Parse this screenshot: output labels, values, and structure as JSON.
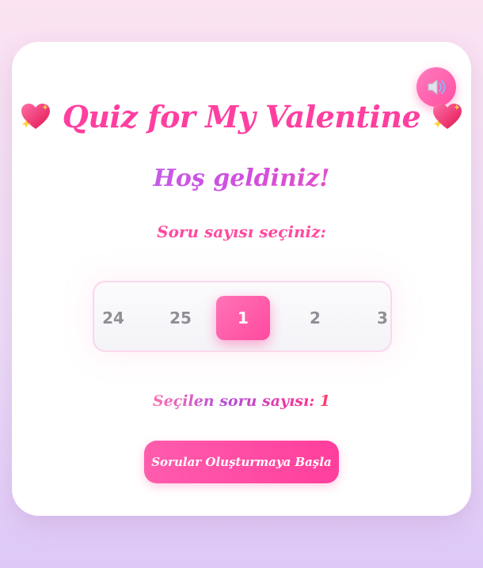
{
  "sound_button": {
    "icon": "speaker-icon"
  },
  "header": {
    "title": "Quiz for My Valentine",
    "left_icon": "sparkling-heart-icon",
    "right_icon": "sparkling-heart-icon"
  },
  "welcome": "Hoş geldiniz!",
  "prompt": "Soru sayısı seçiniz:",
  "picker": {
    "items": [
      "24",
      "25",
      "1",
      "2",
      "3"
    ],
    "selected": "1"
  },
  "selection": {
    "label": "Seçilen soru sayısı:",
    "value": "1"
  },
  "start_button": {
    "label": "Sorular Oluşturmaya Başla"
  },
  "colors": {
    "accent": "#ff4aa0",
    "purple": "#b56cf0",
    "background_top": "#fbe3f1",
    "background_bottom": "#ddc8f7"
  }
}
